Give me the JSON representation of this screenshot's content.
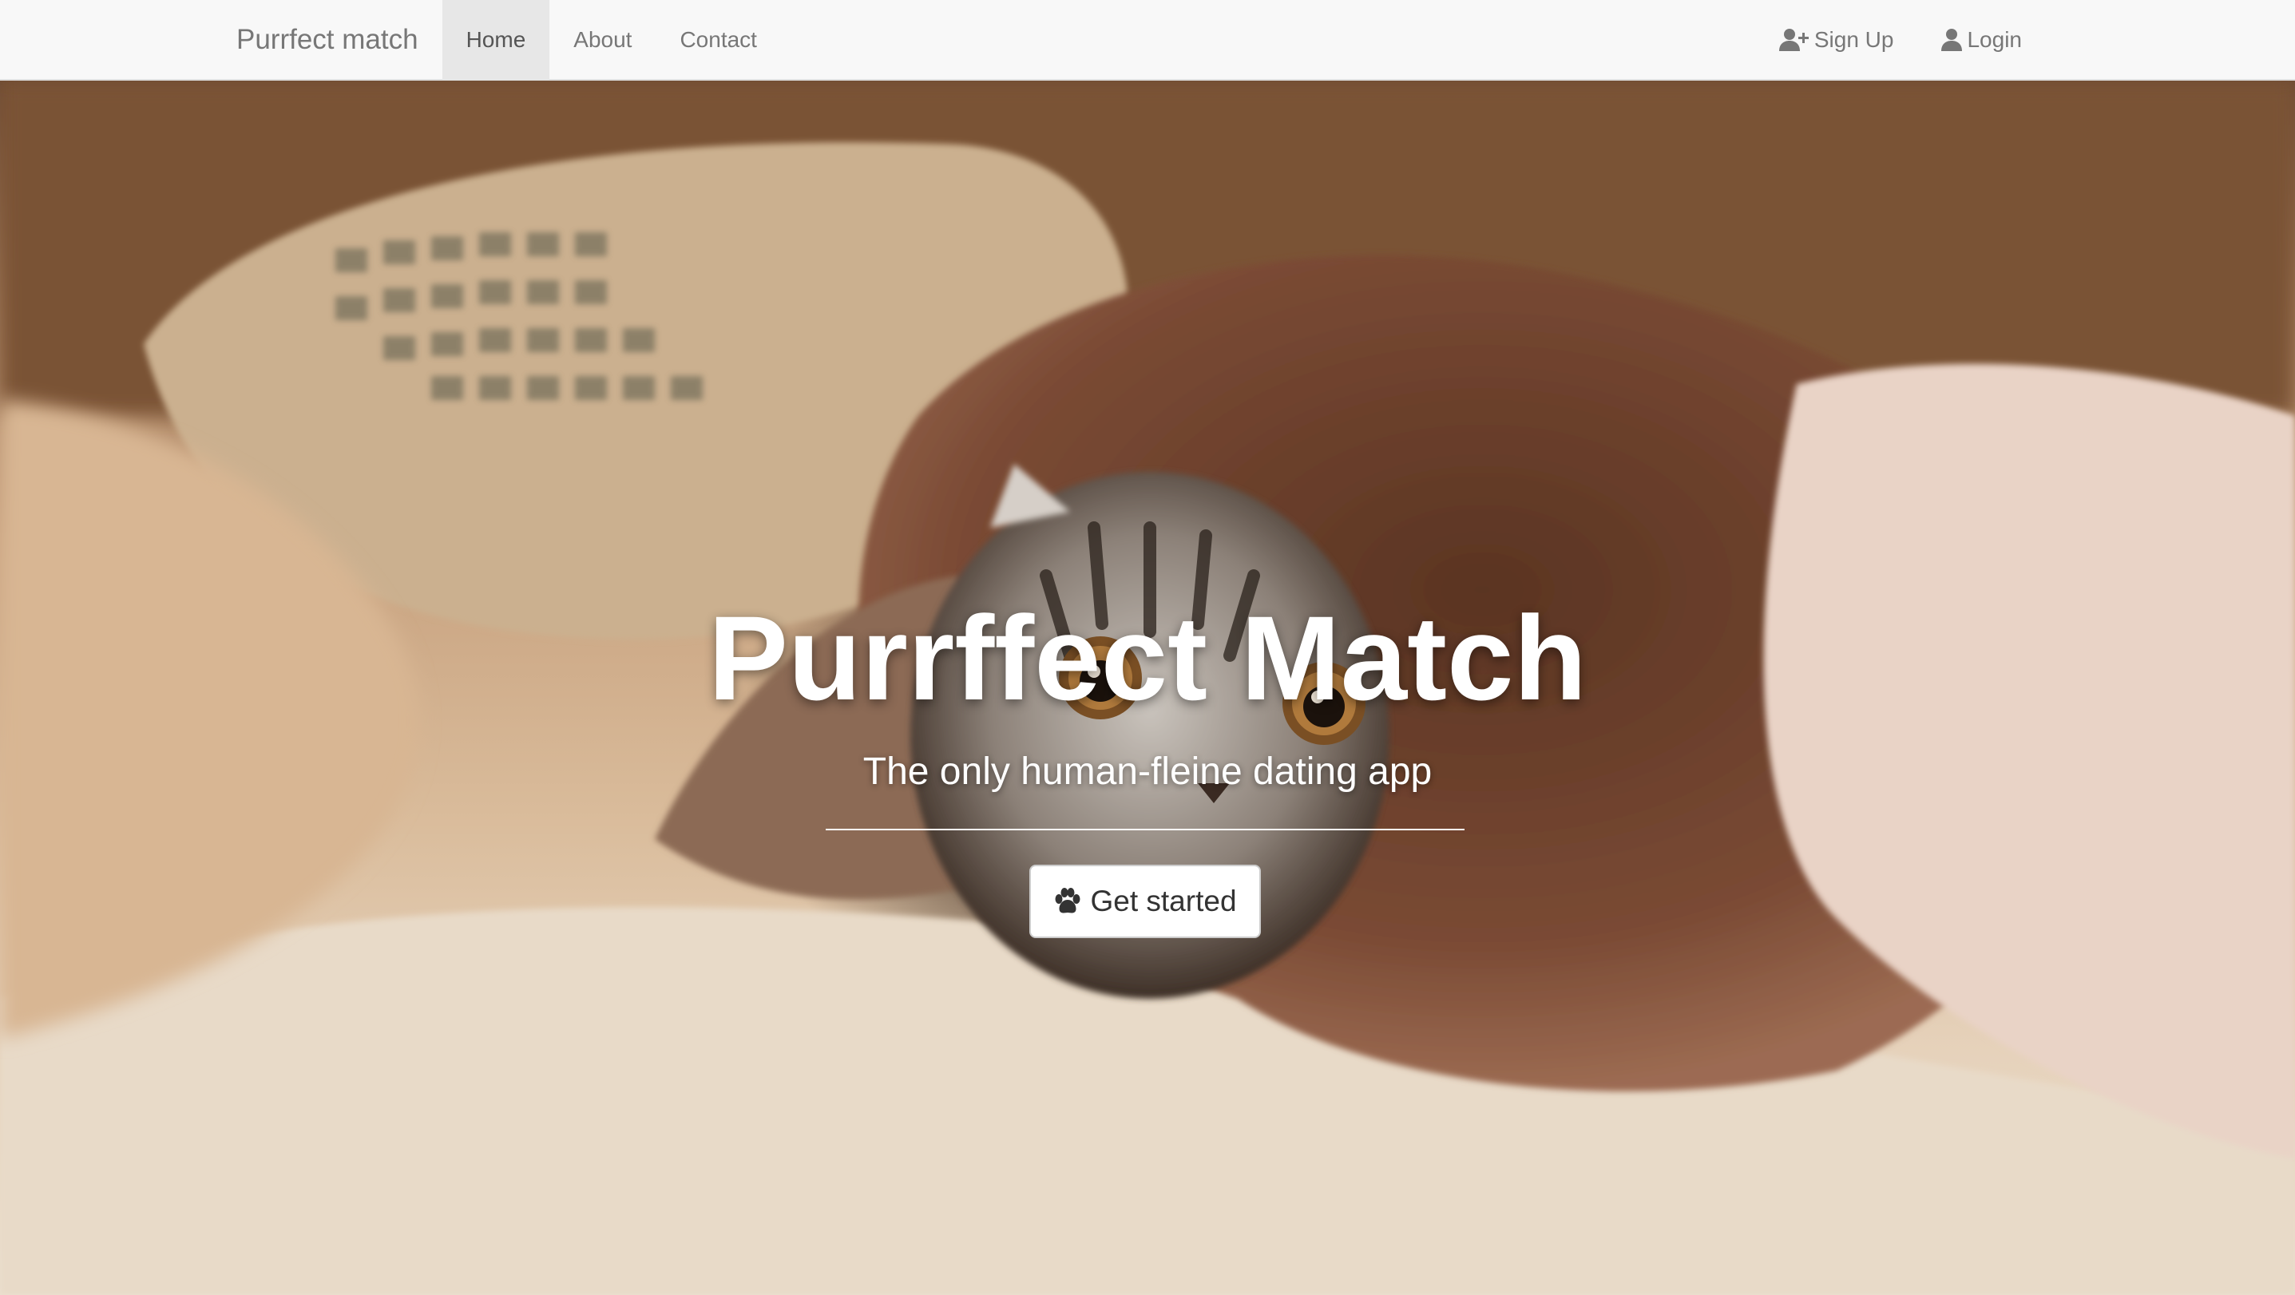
{
  "navbar": {
    "brand": "Purrfect match",
    "left_items": [
      {
        "label": "Home",
        "active": true
      },
      {
        "label": "About",
        "active": false
      },
      {
        "label": "Contact",
        "active": false
      }
    ],
    "right_items": [
      {
        "label": "Sign Up",
        "icon": "user-plus-icon"
      },
      {
        "label": "Login",
        "icon": "user-icon"
      }
    ]
  },
  "hero": {
    "title": "Purrffect Match",
    "subtitle": "The only human-fleine dating app",
    "cta": {
      "label": "Get started",
      "icon": "paw-icon"
    }
  },
  "colors": {
    "navbar_bg": "#f8f8f8",
    "active_item_bg": "#e7e7e7",
    "nav_text": "#777777",
    "hero_text": "#ffffff",
    "button_bg": "#ffffff",
    "button_text": "#333333"
  }
}
